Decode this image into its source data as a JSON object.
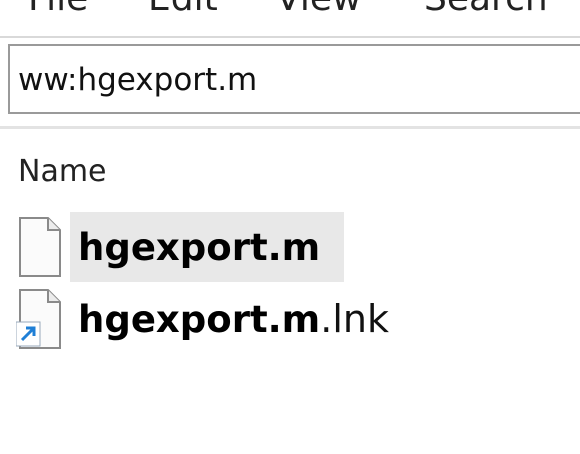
{
  "menu": {
    "file": "File",
    "edit": "Edit",
    "view": "View",
    "search": "Search"
  },
  "address": {
    "value": "ww:hgexport.m"
  },
  "list": {
    "column_name": "Name",
    "items": [
      {
        "name": "hgexport.m",
        "ext": "",
        "icon": "document-icon",
        "selected": true
      },
      {
        "name": "hgexport.m",
        "ext": ".lnk",
        "icon": "shortcut-document-icon",
        "selected": false
      }
    ]
  }
}
